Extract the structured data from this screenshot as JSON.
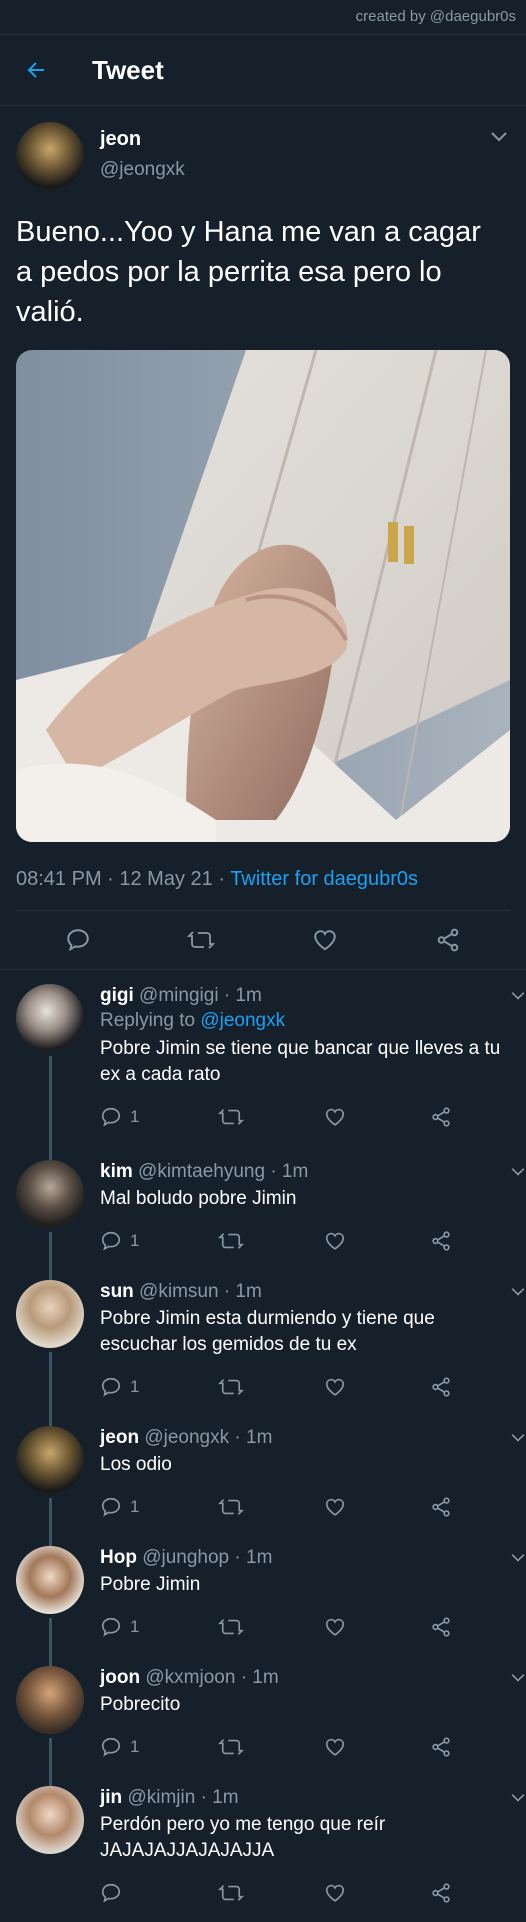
{
  "credit": "created by @daegubr0s",
  "header": {
    "title": "Tweet"
  },
  "tweet": {
    "name": "jeon",
    "handle": "@jeongxk",
    "text": "Bueno...Yoo y Hana me van a cagar a pedos por la perrita esa pero lo valió.",
    "time": "08:41 PM · 12 May 21 · ",
    "source": "Twitter for daegubr0s"
  },
  "replies": [
    {
      "name": "gigi",
      "meta": " @mingigi · 1m",
      "replying_prefix": "Replying to ",
      "replying_to": "@jeongxk",
      "text": "Pobre Jimin se tiene que bancar que lleves a tu ex a cada rato",
      "reply_count": "1"
    },
    {
      "name": "kim",
      "meta": " @kimtaehyung · 1m",
      "text": "Mal boludo pobre Jimin",
      "reply_count": "1"
    },
    {
      "name": "sun",
      "meta": " @kimsun · 1m",
      "text": "Pobre Jimin esta durmiendo y tiene que escuchar los gemidos de tu ex",
      "reply_count": "1"
    },
    {
      "name": "jeon",
      "meta": " @jeongxk · 1m",
      "text": "Los odio",
      "reply_count": "1"
    },
    {
      "name": "Hop",
      "meta": " @junghop · 1m",
      "text": "Pobre Jimin",
      "reply_count": "1"
    },
    {
      "name": "joon",
      "meta": " @kxmjoon · 1m",
      "text": "Pobrecito",
      "reply_count": "1"
    },
    {
      "name": "jin",
      "meta": " @kimjin · 1m",
      "text": "Perdón pero yo me tengo que reír JAJAJAJJAJAJAJJA",
      "reply_count": ""
    }
  ],
  "colors": {
    "background": "#15202b",
    "accent": "#1da1f2",
    "muted": "#8899a6",
    "divider": "#253341"
  }
}
